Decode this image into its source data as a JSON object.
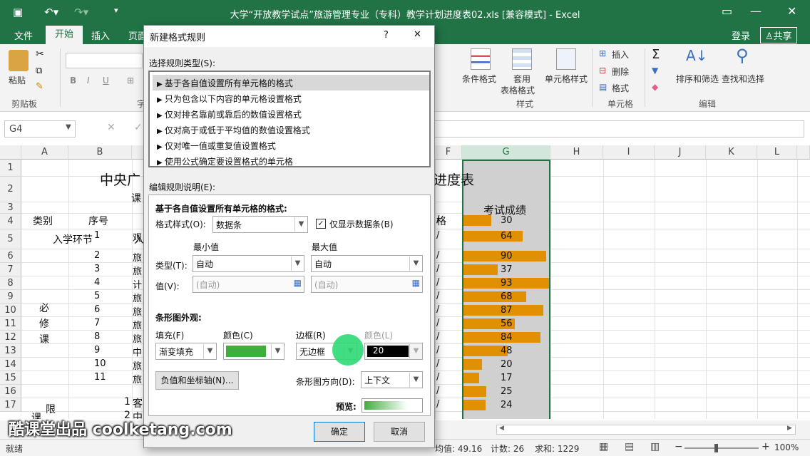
{
  "titlebar": {
    "title": "大学“开放教学试点”旅游管理专业（专科）教学计划进度表02.xls  [兼容模式] - Excel"
  },
  "tabs": {
    "file": "文件",
    "home": "开始",
    "insert": "插入",
    "page": "页面",
    "login": "登录",
    "share": "共享"
  },
  "ribbon": {
    "paste": "粘贴",
    "clipboard": "剪贴板",
    "font_group": "字",
    "cond_format": "条件格式",
    "table_format_1": "套用",
    "table_format_2": "表格格式",
    "cell_style": "单元格样式",
    "styles": "样式",
    "insert": "插入",
    "delete": "删除",
    "format": "格式",
    "cells": "单元格",
    "sort_filter": "排序和筛选",
    "find_select": "查找和选择",
    "editing": "编辑"
  },
  "formula": {
    "namebox": "G4"
  },
  "columns": [
    "A",
    "B",
    "C",
    "D",
    "E",
    "F",
    "G",
    "H",
    "I",
    "J",
    "K",
    "L"
  ],
  "rows": [
    "1",
    "2",
    "3",
    "4",
    "5",
    "6",
    "7",
    "8",
    "9",
    "10",
    "11",
    "12",
    "13",
    "14",
    "15",
    "16",
    "17"
  ],
  "sheet": {
    "title_left": "中央广",
    "title_right": "进度表",
    "course_hdr": "课",
    "cat_hdr": "类别",
    "seq_hdr": "序号",
    "grade_hdr": "考试成绩",
    "col_f_hdr": "格",
    "entry": "入学环节",
    "entry_c": "入",
    "required": "必修课",
    "limited_1": "限",
    "limited_2": "课",
    "seq": [
      "1",
      "2",
      "3",
      "4",
      "5",
      "6",
      "7",
      "8",
      "9",
      "10",
      "11"
    ],
    "c_col": [
      "观",
      "旅",
      "旅",
      "计",
      "旅",
      "旅",
      "旅",
      "旅",
      "中",
      "旅",
      "旅"
    ],
    "r16": "1",
    "r16c": "客",
    "r17": "2",
    "r17c": "中",
    "f_col": [
      "/",
      "/",
      "/",
      "/",
      "/",
      "/",
      "/",
      "/",
      "/",
      "/",
      "/",
      "/",
      "/",
      "/"
    ]
  },
  "chart_data": {
    "type": "bar",
    "title": "",
    "xlabel": "",
    "ylabel": "",
    "categories": [
      "4",
      "5",
      "6",
      "7",
      "8",
      "9",
      "10",
      "11",
      "12",
      "13",
      "14",
      "15",
      "16",
      "17"
    ],
    "values": [
      30,
      64,
      90,
      37,
      93,
      68,
      87,
      56,
      84,
      48,
      20,
      17,
      25,
      24
    ],
    "xlim": [
      0,
      93
    ]
  },
  "status": {
    "ready": "就绪",
    "avg": "均值: 49.16",
    "count": "计数: 26",
    "sum": "求和: 1229",
    "zoom": "100%"
  },
  "dialog": {
    "title": "新建格式规则",
    "help": "?",
    "close": "✕",
    "rule_type_label": "选择规则类型(S):",
    "rule_types": [
      "基于各自值设置所有单元格的格式",
      "只为包含以下内容的单元格设置格式",
      "仅对排名靠前或靠后的数值设置格式",
      "仅对高于或低于平均值的数值设置格式",
      "仅对唯一值或重复值设置格式",
      "使用公式确定要设置格式的单元格"
    ],
    "edit_label": "编辑规则说明(E):",
    "section": "基于各自值设置所有单元格的格式:",
    "format_style_label": "格式样式(O):",
    "format_style": "数据条",
    "show_bar_only": "仅显示数据条(B)",
    "min": "最小值",
    "max": "最大值",
    "type_label": "类型(T):",
    "min_type": "自动",
    "max_type": "自动",
    "value_label": "值(V):",
    "min_value": "(自动)",
    "max_value": "(自动)",
    "bar_appearance": "条形图外观:",
    "fill_label": "填充(F)",
    "fill": "渐变填充",
    "color_label": "颜色(C)",
    "border_label": "边框(R)",
    "border": "无边框",
    "border_color_label": "颜色(L)",
    "border_color_value": "20",
    "neg_axis": "负值和坐标轴(N)...",
    "direction_label": "条形图方向(D):",
    "direction": "上下文",
    "preview": "预览:",
    "ok": "确定",
    "cancel": "取消",
    "colors": {
      "fill": "#3fae3f",
      "border": "#000000"
    }
  },
  "watermark": "酷课堂出品 coolketang.com"
}
